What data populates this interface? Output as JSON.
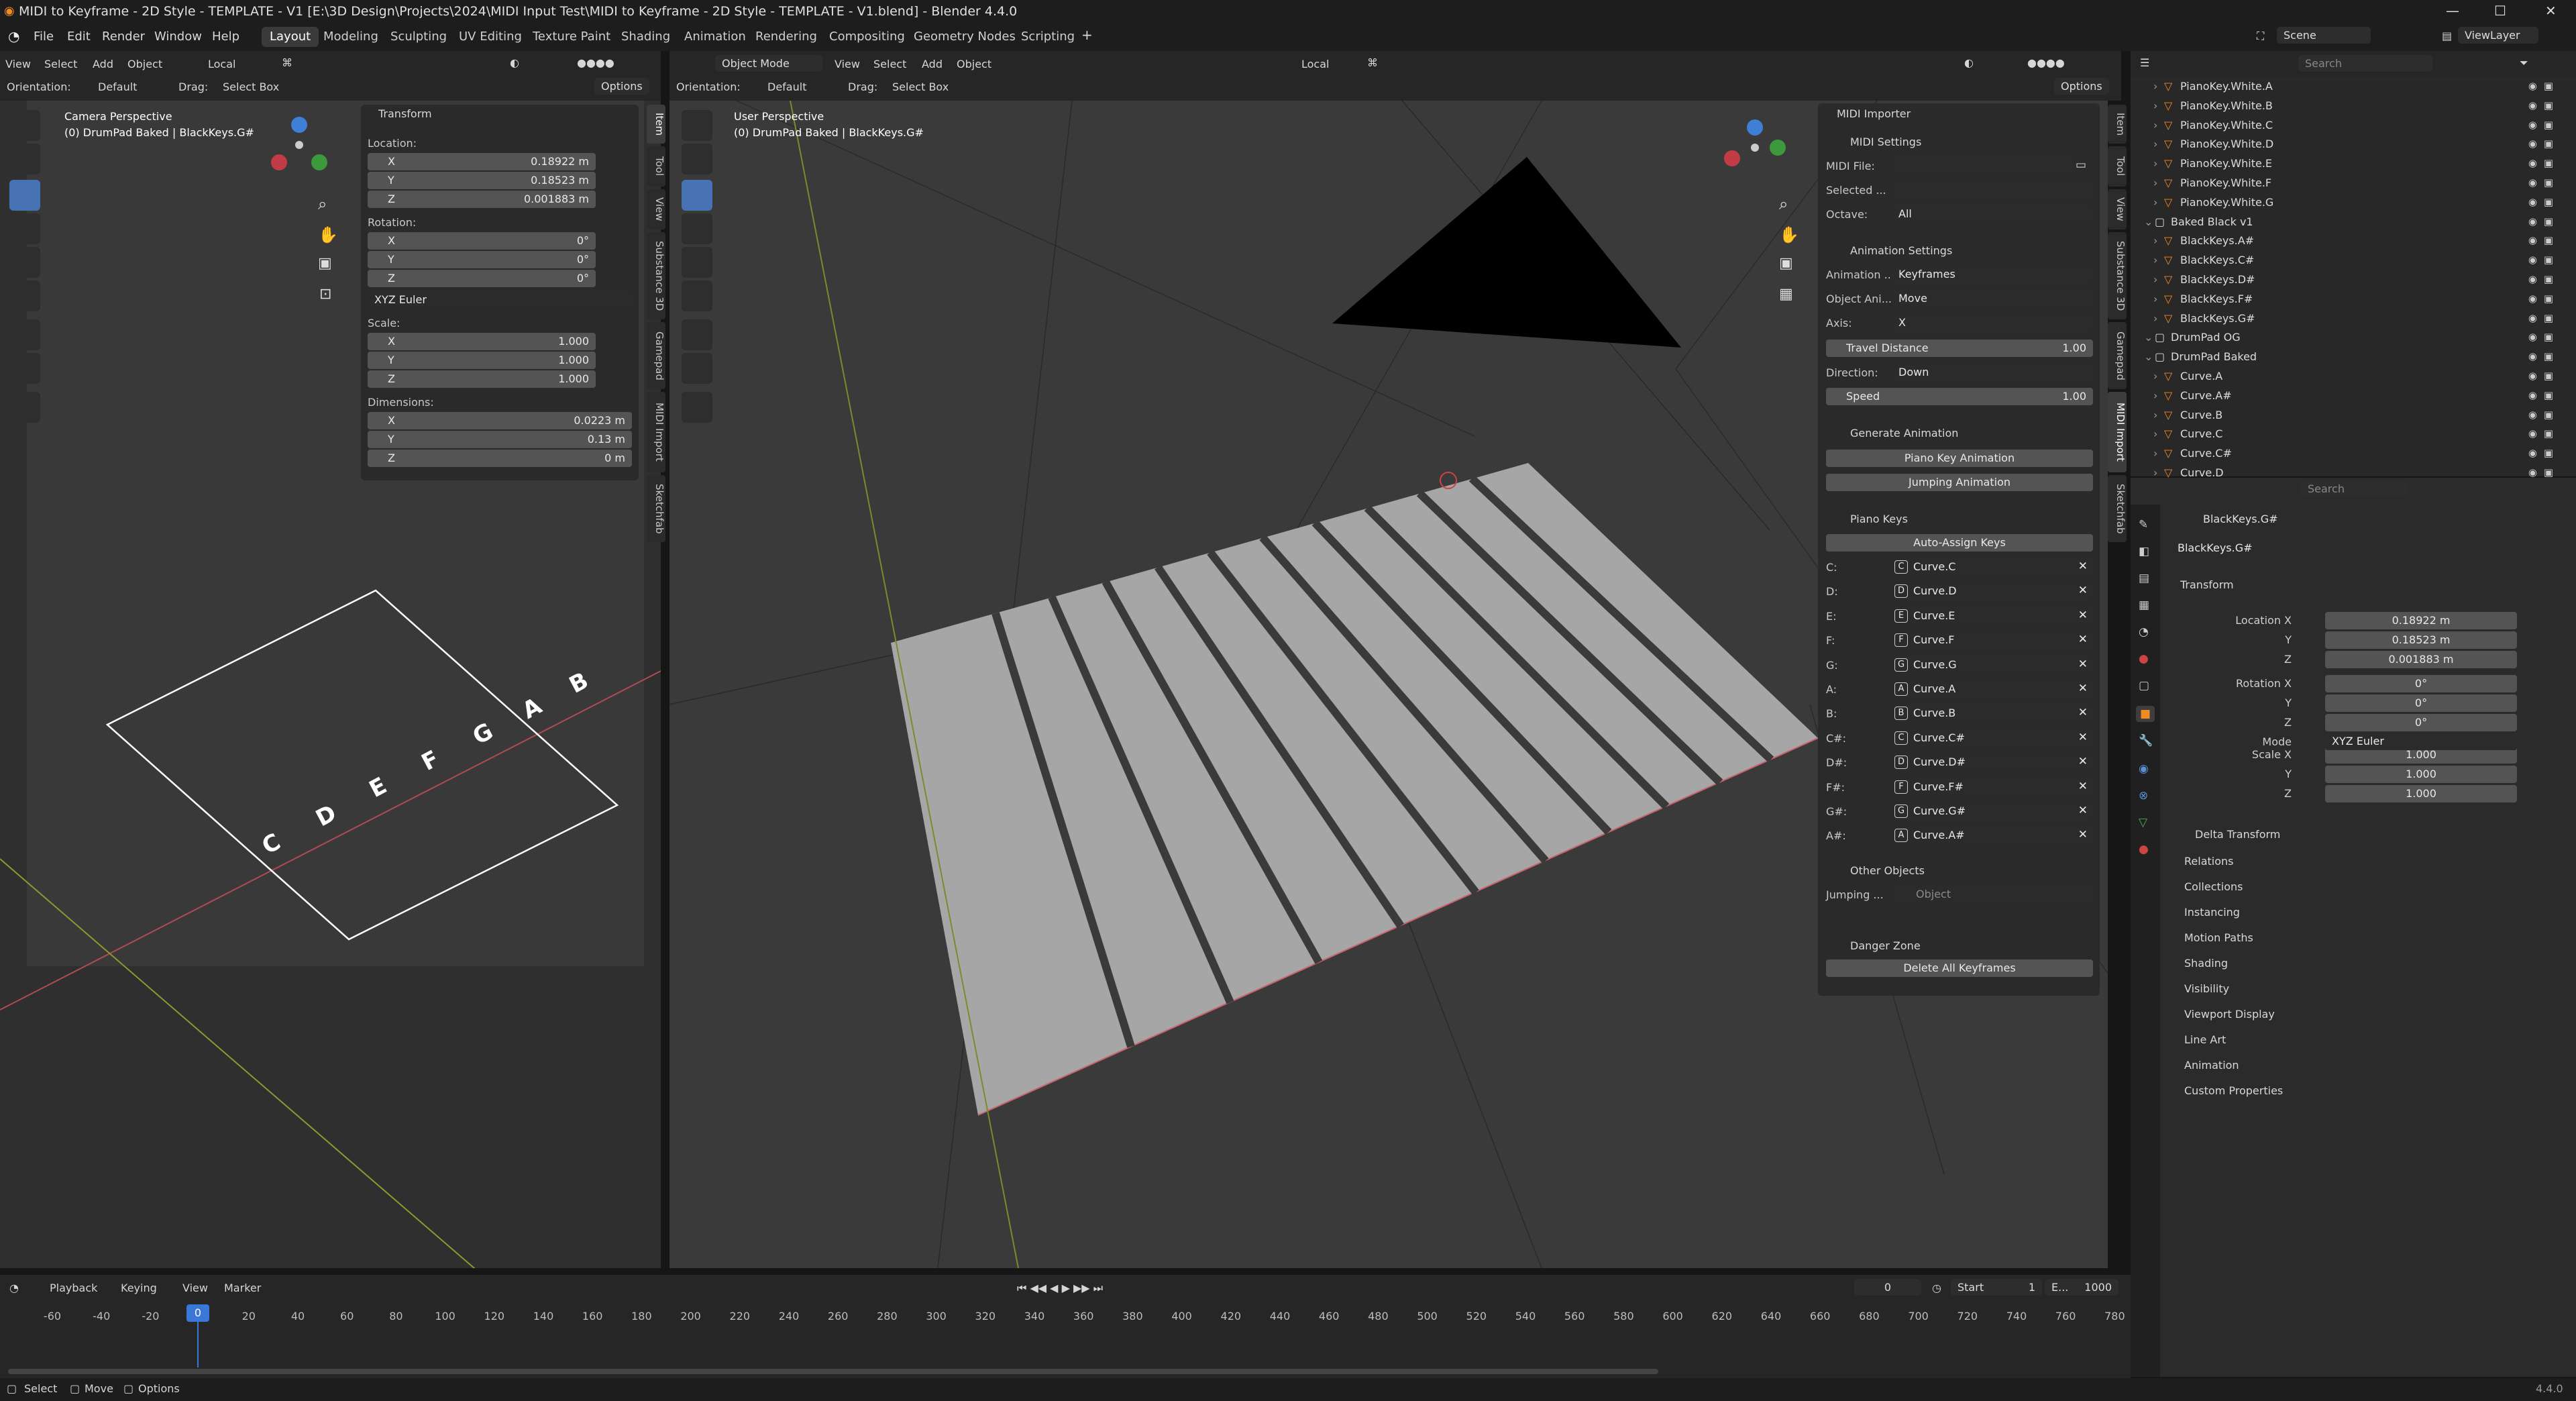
{
  "window": {
    "title": "MIDI to Keyframe - 2D Style - TEMPLATE - V1 [E:\\3D Design\\Projects\\2024\\MIDI Input Test\\MIDI to Keyframe - 2D Style - TEMPLATE - V1.blend] - Blender 4.4.0"
  },
  "menu": [
    "File",
    "Edit",
    "Render",
    "Window",
    "Help"
  ],
  "workspaces": [
    "Layout",
    "Modeling",
    "Sculpting",
    "UV Editing",
    "Texture Paint",
    "Shading",
    "Animation",
    "Rendering",
    "Compositing",
    "Geometry Nodes",
    "Scripting"
  ],
  "top_right": {
    "scene": "Scene",
    "view_layer": "ViewLayer"
  },
  "left_vp": {
    "menus": [
      "View",
      "Select",
      "Add",
      "Object"
    ],
    "transform_space": "Local",
    "orientation_label": "Orientation:",
    "orientation": "Default",
    "drag_label": "Drag:",
    "drag": "Select Box",
    "options": "Options",
    "view_name": "Camera Perspective",
    "view_obj": "(0) DrumPad Baked | BlackKeys.G#",
    "keys": [
      "C",
      "D",
      "E",
      "F",
      "G",
      "A",
      "B"
    ],
    "tabs": [
      "Item",
      "Tool",
      "View",
      "Substance 3D",
      "Gamepad",
      "MIDI Import",
      "Sketchfab"
    ],
    "transform": {
      "title": "Transform",
      "location_label": "Location:",
      "loc": [
        {
          "a": "X",
          "v": "0.18922 m"
        },
        {
          "a": "Y",
          "v": "0.18523 m"
        },
        {
          "a": "Z",
          "v": "0.001883 m"
        }
      ],
      "rotation_label": "Rotation:",
      "rot": [
        {
          "a": "X",
          "v": "0°"
        },
        {
          "a": "Y",
          "v": "0°"
        },
        {
          "a": "Z",
          "v": "0°"
        }
      ],
      "rot_mode": "XYZ Euler",
      "scale_label": "Scale:",
      "scale": [
        {
          "a": "X",
          "v": "1.000"
        },
        {
          "a": "Y",
          "v": "1.000"
        },
        {
          "a": "Z",
          "v": "1.000"
        }
      ],
      "dimensions_label": "Dimensions:",
      "dim": [
        {
          "a": "X",
          "v": "0.0223 m"
        },
        {
          "a": "Y",
          "v": "0.13 m"
        },
        {
          "a": "Z",
          "v": "0 m"
        }
      ]
    }
  },
  "main_vp": {
    "mode": "Object Mode",
    "menus": [
      "View",
      "Select",
      "Add",
      "Object"
    ],
    "transform_space": "Local",
    "orientation_label": "Orientation:",
    "orientation": "Default",
    "drag_label": "Drag:",
    "drag": "Select Box",
    "options": "Options",
    "view_name": "User Perspective",
    "view_obj": "(0) DrumPad Baked | BlackKeys.G#",
    "tabs": [
      "Item",
      "Tool",
      "View",
      "Substance 3D",
      "Gamepad",
      "MIDI Import",
      "Sketchfab"
    ]
  },
  "midi": {
    "title": "MIDI Importer",
    "midi_settings": "MIDI Settings",
    "midi_file_label": "MIDI File:",
    "selected_label": "Selected ...",
    "octave_label": "Octave:",
    "octave": "All",
    "anim_settings": "Animation Settings",
    "animation_label": "Animation ...",
    "animation": "Keyframes",
    "object_anim_label": "Object Ani...",
    "object_anim": "Move",
    "axis_label": "Axis:",
    "axis": "X",
    "travel_label": "Travel Distance",
    "travel": "1.00",
    "direction_label": "Direction:",
    "direction": "Down",
    "speed_label": "Speed",
    "speed": "1.00",
    "gen_anim": "Generate Animation",
    "piano_btn": "Piano Key Animation",
    "jump_btn": "Jumping Animation",
    "piano_keys": "Piano Keys",
    "auto_assign": "Auto-Assign Keys",
    "keys": [
      {
        "k": "C:",
        "i": "C",
        "c": "Curve.C"
      },
      {
        "k": "D:",
        "i": "D",
        "c": "Curve.D"
      },
      {
        "k": "E:",
        "i": "E",
        "c": "Curve.E"
      },
      {
        "k": "F:",
        "i": "F",
        "c": "Curve.F"
      },
      {
        "k": "G:",
        "i": "G",
        "c": "Curve.G"
      },
      {
        "k": "A:",
        "i": "A",
        "c": "Curve.A"
      },
      {
        "k": "B:",
        "i": "B",
        "c": "Curve.B"
      },
      {
        "k": "C#:",
        "i": "C",
        "c": "Curve.C#"
      },
      {
        "k": "D#:",
        "i": "D",
        "c": "Curve.D#"
      },
      {
        "k": "F#:",
        "i": "F",
        "c": "Curve.F#"
      },
      {
        "k": "G#:",
        "i": "G",
        "c": "Curve.G#"
      },
      {
        "k": "A#:",
        "i": "A",
        "c": "Curve.A#"
      }
    ],
    "other_objects": "Other Objects",
    "jumping_label": "Jumping ...",
    "jumping_placeholder": "Object",
    "danger": "Danger Zone",
    "delete_btn": "Delete All Keyframes"
  },
  "outliner": {
    "search": "Search",
    "rows": [
      {
        "n": "PianoKey.White.A",
        "d": 1
      },
      {
        "n": "PianoKey.White.B",
        "d": 1
      },
      {
        "n": "PianoKey.White.C",
        "d": 1
      },
      {
        "n": "PianoKey.White.D",
        "d": 1
      },
      {
        "n": "PianoKey.White.E",
        "d": 1
      },
      {
        "n": "PianoKey.White.F",
        "d": 1
      },
      {
        "n": "PianoKey.White.G",
        "d": 1
      },
      {
        "n": "Baked Black v1",
        "d": 0
      },
      {
        "n": "BlackKeys.A#",
        "d": 1
      },
      {
        "n": "BlackKeys.C#",
        "d": 1
      },
      {
        "n": "BlackKeys.D#",
        "d": 1
      },
      {
        "n": "BlackKeys.F#",
        "d": 1
      },
      {
        "n": "BlackKeys.G#",
        "d": 1
      },
      {
        "n": "DrumPad OG",
        "d": 0
      },
      {
        "n": "DrumPad Baked",
        "d": 0
      },
      {
        "n": "Curve.A",
        "d": 1
      },
      {
        "n": "Curve.A#",
        "d": 1
      },
      {
        "n": "Curve.B",
        "d": 1
      },
      {
        "n": "Curve.C",
        "d": 1
      },
      {
        "n": "Curve.C#",
        "d": 1
      },
      {
        "n": "Curve.D",
        "d": 1
      }
    ]
  },
  "props": {
    "search": "Search",
    "object": "BlackKeys.G#",
    "obj_field": "BlackKeys.G#",
    "transform": "Transform",
    "loc": [
      {
        "l": "Location X",
        "v": "0.18922 m"
      },
      {
        "l": "Y",
        "v": "0.18523 m"
      },
      {
        "l": "Z",
        "v": "0.001883 m"
      }
    ],
    "rot": [
      {
        "l": "Rotation X",
        "v": "0°"
      },
      {
        "l": "Y",
        "v": "0°"
      },
      {
        "l": "Z",
        "v": "0°"
      }
    ],
    "mode_label": "Mode",
    "mode": "XYZ Euler",
    "scale": [
      {
        "l": "Scale X",
        "v": "1.000"
      },
      {
        "l": "Y",
        "v": "1.000"
      },
      {
        "l": "Z",
        "v": "1.000"
      }
    ],
    "delta": "Delta Transform",
    "sections": [
      "Relations",
      "Collections",
      "Instancing",
      "Motion Paths",
      "Shading",
      "Visibility",
      "Viewport Display",
      "Line Art",
      "Animation",
      "Custom Properties"
    ]
  },
  "timeline": {
    "menus": [
      "Playback",
      "Keying",
      "View",
      "Marker"
    ],
    "current": "0",
    "start_label": "Start",
    "start": "1",
    "end_label": "E...",
    "end": "1000",
    "frame": "0",
    "ticks": [
      "-60",
      "-40",
      "-20",
      "0",
      "20",
      "40",
      "60",
      "80",
      "100",
      "120",
      "140",
      "160",
      "180",
      "200",
      "220",
      "240",
      "260",
      "280",
      "300",
      "320",
      "340",
      "360",
      "380",
      "400",
      "420",
      "440",
      "460",
      "480",
      "500",
      "520",
      "540",
      "560",
      "580",
      "600",
      "620",
      "640",
      "660",
      "680",
      "700",
      "720",
      "740",
      "760",
      "780"
    ]
  },
  "status": {
    "select": "Select",
    "move": "Move",
    "options": "Options",
    "version": "4.4.0"
  }
}
